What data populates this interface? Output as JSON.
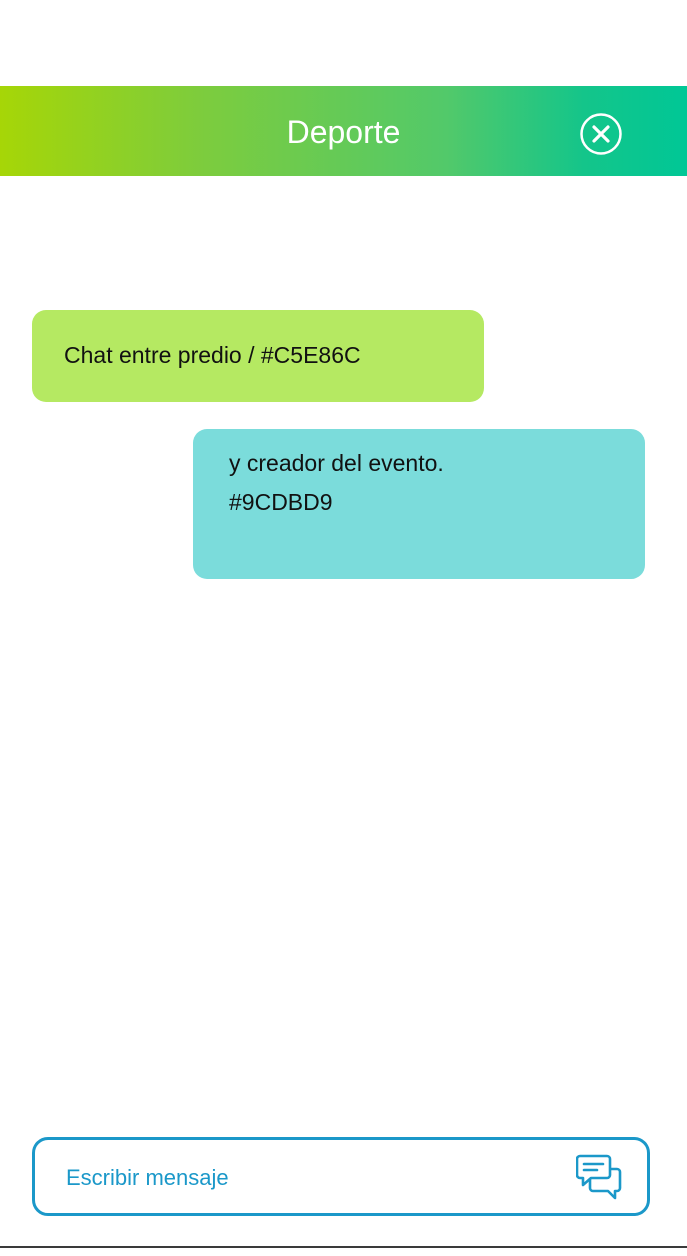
{
  "header": {
    "title": "Deporte",
    "close_icon": "close-circle-icon",
    "gradient_start": "#a6d607",
    "gradient_end": "#00c796"
  },
  "messages": [
    {
      "side": "left",
      "lines": [
        "Chat entre predio / #C5E86C"
      ],
      "background": "#b5e962"
    },
    {
      "side": "right",
      "lines": [
        "y creador del evento.",
        "#9CDBD9"
      ],
      "background": "#7bdcdb"
    }
  ],
  "composer": {
    "placeholder": "Escribir mensaje",
    "value": "",
    "send_icon": "chat-bubbles-icon",
    "accent": "#1b98c9"
  }
}
